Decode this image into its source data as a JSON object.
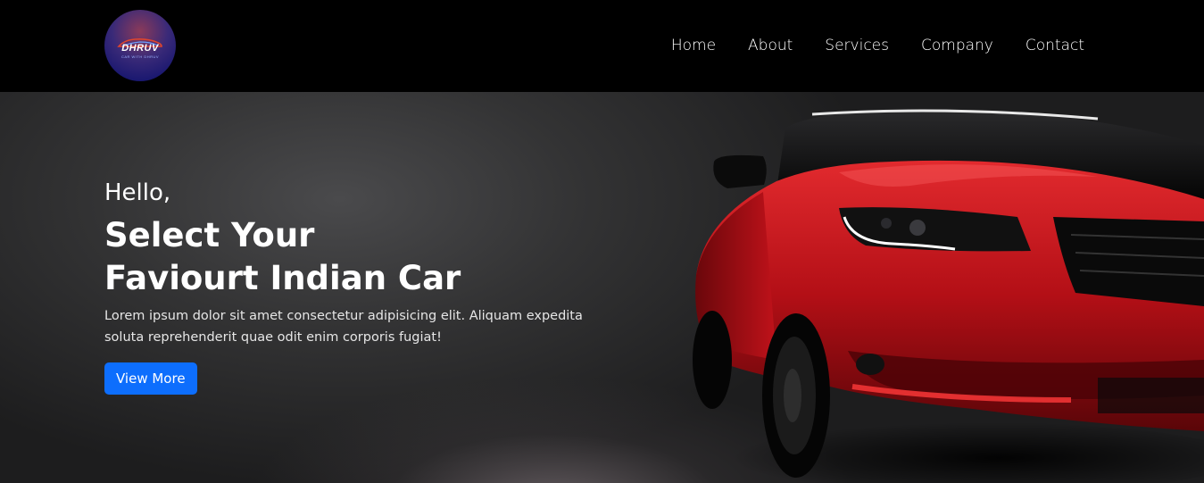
{
  "brand": {
    "logo_text": "DHRUV",
    "logo_tagline": "CAR WITH DHRUV"
  },
  "nav": {
    "items": [
      "Home",
      "About",
      "Services",
      "Company",
      "Contact"
    ]
  },
  "hero": {
    "greeting": "Hello,",
    "headline_line1": "Select Your",
    "headline_line2": "Faviourt Indian Car",
    "description": "Lorem ipsum dolor sit amet consectetur adipisicing elit. Aliquam expedita soluta reprehenderit quae odit enim corporis fugiat!",
    "cta_label": "View More"
  },
  "colors": {
    "navbar_bg": "#000000",
    "button_accent": "#0d6efd",
    "car_red": "#c0121a"
  }
}
